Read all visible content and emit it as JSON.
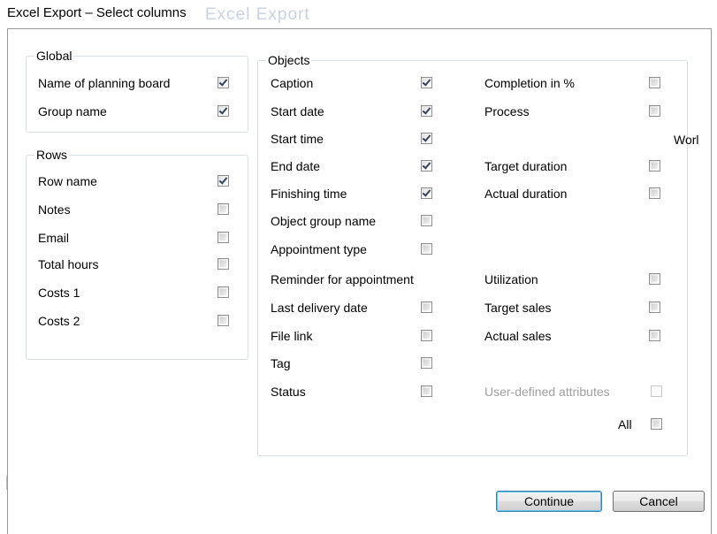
{
  "window": {
    "title": "Excel Export – Select columns",
    "background_title": "Excel Export"
  },
  "global": {
    "caption": "Global",
    "items": [
      {
        "label": "Name of planning board",
        "checked": true
      },
      {
        "label": "Group name",
        "checked": true
      }
    ]
  },
  "rows": {
    "caption": "Rows",
    "items": [
      {
        "label": "Row name",
        "checked": true
      },
      {
        "label": "Notes",
        "checked": false
      },
      {
        "label": "Email",
        "checked": false
      },
      {
        "label": "Total hours",
        "checked": false
      },
      {
        "label": "Costs 1",
        "checked": false
      },
      {
        "label": "Costs 2",
        "checked": false
      }
    ]
  },
  "objects": {
    "caption": "Objects",
    "left_items": [
      {
        "label": "Caption",
        "checked": true
      },
      {
        "label": "Start date",
        "checked": true
      },
      {
        "label": "Start time",
        "checked": true
      },
      {
        "label": "End date",
        "checked": true
      },
      {
        "label": "Finishing time",
        "checked": true
      },
      {
        "label": "Object group name",
        "checked": false
      },
      {
        "label": "Appointment type",
        "checked": false
      },
      {
        "label": "Reminder for appointment",
        "checked": false
      },
      {
        "label": "Last delivery date",
        "checked": false
      },
      {
        "label": "File link",
        "checked": false
      },
      {
        "label": "Tag",
        "checked": false
      },
      {
        "label": "Status",
        "checked": false
      }
    ],
    "right_items": [
      {
        "label": "Completion in %",
        "checked": false
      },
      {
        "label": "Process",
        "checked": false
      },
      {
        "label": "Target duration",
        "checked": false
      },
      {
        "label": "Actual duration",
        "checked": false
      },
      {
        "label": "Utilization",
        "checked": false
      },
      {
        "label": "Target sales",
        "checked": false
      },
      {
        "label": "Actual sales",
        "checked": false
      },
      {
        "label": "User-defined attributes",
        "checked": false,
        "disabled": true
      }
    ],
    "truncated_label": "Worl",
    "all_label": "All",
    "all_checked": false
  },
  "buttons": {
    "continue": "Continue",
    "cancel": "Cancel"
  }
}
